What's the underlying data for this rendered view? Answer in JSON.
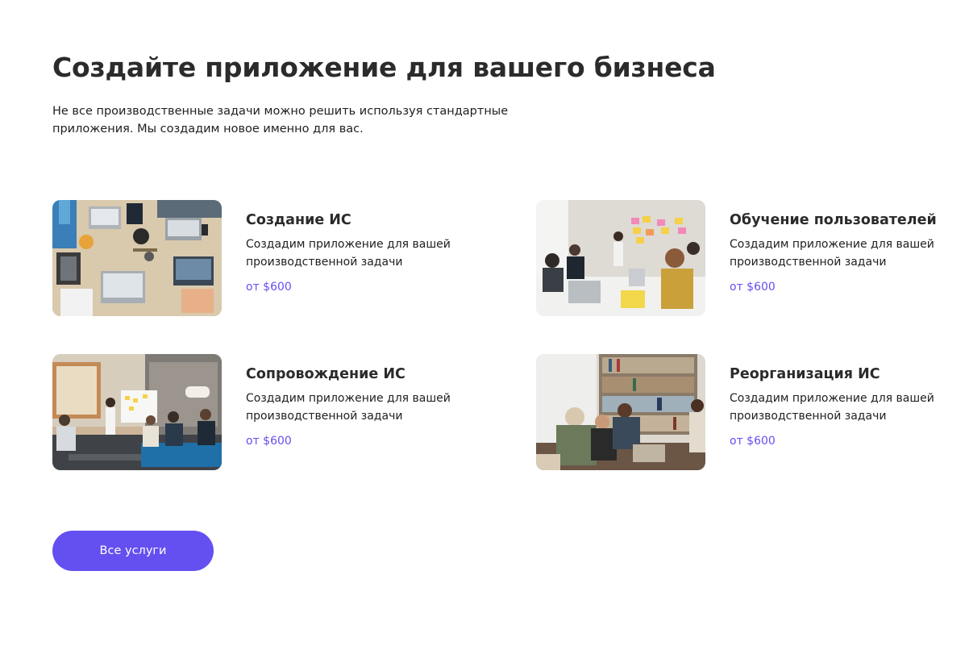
{
  "header": {
    "title": "Создайте приложение для вашего бизнеса",
    "subtitle": "Не все производственные задачи можно решить используя стандартные приложения. Мы создадим новое именно для вас."
  },
  "services": [
    {
      "title": "Создание ИС",
      "description": "Создадим приложение для вашей производственной задачи",
      "price": "от $600",
      "image": "team-laptops-desk-photo"
    },
    {
      "title": "Обучение пользователей",
      "description": "Создадим приложение для вашей производственной задачи",
      "price": "от $600",
      "image": "training-meeting-photo"
    },
    {
      "title": "Сопровождение ИС",
      "description": "Создадим приложение для вашей производственной задачи",
      "price": "от $600",
      "image": "office-presentation-photo"
    },
    {
      "title": "Реорганизация ИС",
      "description": "Создадим приложение для вашей производственной задачи",
      "price": "от $600",
      "image": "library-team-photo"
    }
  ],
  "cta": {
    "all_services_label": "Все услуги"
  },
  "colors": {
    "accent": "#6450f0",
    "heading": "#2b2b2b",
    "body_text": "#1f1f1f",
    "background": "#ffffff"
  }
}
